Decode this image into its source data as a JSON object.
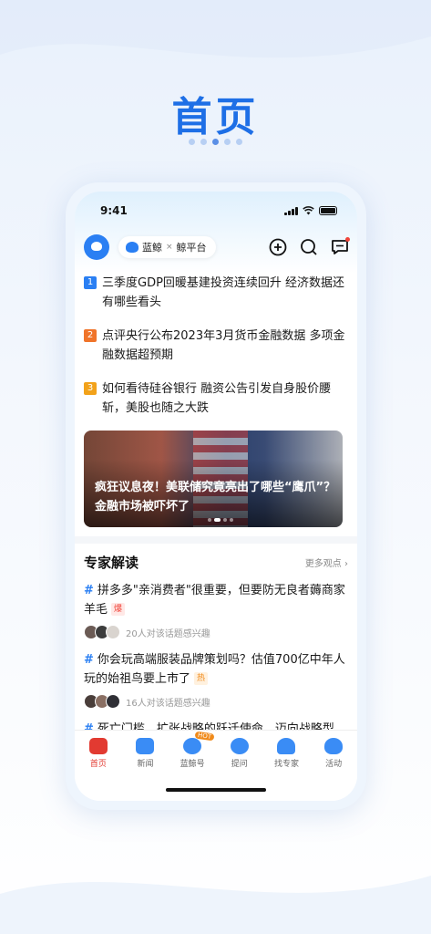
{
  "promo": {
    "title": "首页",
    "pages": 5,
    "active_page": 3
  },
  "status": {
    "time": "9:41"
  },
  "appbar": {
    "brand_main": "蓝鲸",
    "brand_x": "×",
    "brand_partner": "鲸平台",
    "icons": [
      "add-circle-icon",
      "search-icon",
      "message-icon"
    ]
  },
  "headlines": [
    {
      "rank": "1",
      "color": "#2a7ff3",
      "text": "三季度GDP回暖基建投资连续回升 经济数据还有哪些看头"
    },
    {
      "rank": "2",
      "color": "#f0742a",
      "text": "点评央行公布2023年3月货币金融数据 多项金融数据超预期"
    },
    {
      "rank": "3",
      "color": "#f2a21a",
      "text": "如何看待硅谷银行 融资公告引发自身股价腰斩，美股也随之大跌"
    }
  ],
  "banner": {
    "text": "疯狂议息夜！美联储究竟亮出了哪些“鹰爪”？金融市场被吓坏了",
    "slides": 4,
    "active_slide": 2
  },
  "expert": {
    "title": "专家解读",
    "more": "更多观点",
    "topics": [
      {
        "text": "拼多多\"亲消费者\"很重要，但要防无良者薅商家羊毛",
        "tag": "爆",
        "interest": "20人对该话题感兴趣"
      },
      {
        "text": "你会玩高端服装品牌策划吗？估值700亿中年人玩的始祖鸟要上市了",
        "tag": "热",
        "interest": "16人对该话题感兴趣"
      },
      {
        "text": "死亡门槛、扩张战略的跃迁使命、迈向战略型"
      }
    ]
  },
  "tabbar": {
    "tabs": [
      {
        "label": "首页",
        "icon": "home-icon",
        "color": "#e23a31"
      },
      {
        "label": "新闻",
        "icon": "news-icon",
        "color": "#3a8cf5"
      },
      {
        "label": "蓝鲸号",
        "icon": "whale-icon",
        "color": "#3a8cf5",
        "badge": "HOT"
      },
      {
        "label": "提问",
        "icon": "question-icon",
        "color": "#3a8cf5"
      },
      {
        "label": "找专家",
        "icon": "expert-icon",
        "color": "#3a8cf5"
      },
      {
        "label": "活动",
        "icon": "activity-icon",
        "color": "#3a8cf5"
      }
    ]
  }
}
